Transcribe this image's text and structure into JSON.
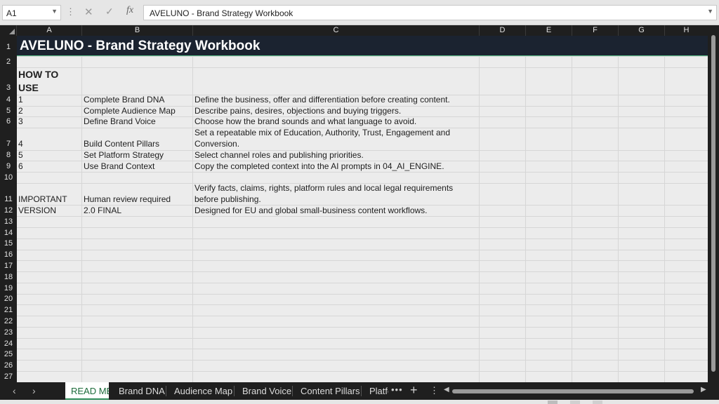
{
  "formula_bar": {
    "name_box": "A1",
    "cancel_icon": "✕",
    "enter_icon": "✓",
    "fx_label": "fx",
    "content": "AVELUNO - Brand Strategy Workbook"
  },
  "columns": [
    "A",
    "B",
    "C",
    "D",
    "E",
    "F",
    "G",
    "H"
  ],
  "rows": [
    "1",
    "2",
    "3",
    "4",
    "5",
    "6",
    "7",
    "8",
    "9",
    "10",
    "11",
    "12",
    "13",
    "14",
    "15",
    "16",
    "17",
    "18",
    "19",
    "20",
    "21",
    "22",
    "23",
    "24",
    "25",
    "26",
    "27"
  ],
  "sheet": {
    "title": "AVELUNO - Brand Strategy Workbook",
    "how_to_use": "HOW TO USE",
    "steps": [
      {
        "num": "1",
        "action": "Complete Brand DNA",
        "desc": "Define the business, offer and differentiation before creating content."
      },
      {
        "num": "2",
        "action": "Complete Audience Map",
        "desc": "Describe pains, desires, objections and buying triggers."
      },
      {
        "num": "3",
        "action": "Define Brand Voice",
        "desc": "Choose how the brand sounds and what language to avoid."
      },
      {
        "num": "4",
        "action": "Build Content Pillars",
        "desc": "Set a repeatable mix of Education, Authority, Trust, Engagement and Conversion."
      },
      {
        "num": "5",
        "action": "Set Platform Strategy",
        "desc": "Select channel roles and publishing priorities."
      },
      {
        "num": "6",
        "action": "Use Brand Context",
        "desc": "Copy the completed context into the AI prompts in 04_AI_ENGINE."
      }
    ],
    "important": {
      "label": "IMPORTANT",
      "value": "Human review required",
      "desc": "Verify facts, claims, rights, platform rules and local legal requirements before publishing."
    },
    "version": {
      "label": "VERSION",
      "value": "2.0 FINAL",
      "desc": "Designed for EU and global small-business content workflows."
    }
  },
  "tabs": {
    "nav_prev": "‹",
    "nav_next": "›",
    "items": [
      "READ ME",
      "Brand DNA",
      "Audience Map",
      "Brand Voice",
      "Content Pillars",
      "Platfo"
    ],
    "more": "•••",
    "add": "+",
    "options": "⋮",
    "active_index": 0
  },
  "colors": {
    "title_bg": "#1b2330",
    "title_text": "#ffffff",
    "grid_bg": "#ececec",
    "header_bg": "#1f1f1f",
    "active_tab": "#2e8b57"
  }
}
